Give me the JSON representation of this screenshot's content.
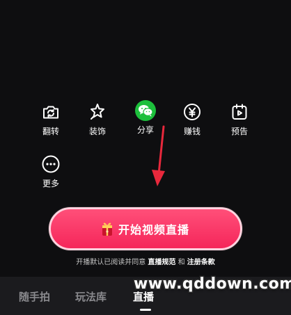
{
  "tools": [
    {
      "label": "翻转",
      "icon": "camera-flip-icon"
    },
    {
      "label": "装饰",
      "icon": "sparkle-icon"
    },
    {
      "label": "分享",
      "icon": "wechat-icon"
    },
    {
      "label": "赚钱",
      "icon": "yen-icon"
    },
    {
      "label": "预告",
      "icon": "calendar-play-icon"
    },
    {
      "label": "更多",
      "icon": "more-icon"
    }
  ],
  "start_button": {
    "label": "开始视频直播",
    "icon": "gift-icon"
  },
  "agreement": {
    "prefix": "开播默认已阅读并同意 ",
    "link1": "直播规范",
    "conj": " 和 ",
    "link2": "注册条款"
  },
  "tabs": [
    {
      "label": "随手拍"
    },
    {
      "label": "玩法库"
    },
    {
      "label": "直播",
      "active": true
    }
  ],
  "watermark": "www.qddown.com",
  "colors": {
    "accent": "#f5265a",
    "wechat_green": "#1dbf3c",
    "annotation_arrow": "#e8283c"
  }
}
